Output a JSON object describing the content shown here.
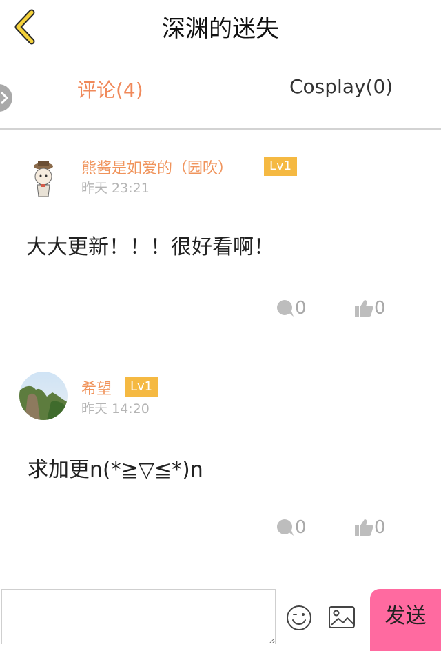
{
  "header": {
    "title": "深渊的迷失"
  },
  "tabs": [
    {
      "label": "评论(4)",
      "active": true
    },
    {
      "label": "Cosplay(0)",
      "active": false
    }
  ],
  "comments": [
    {
      "username": "熊酱是如爱的（园吹）",
      "level": "Lv1",
      "time": "昨天 23:21",
      "content": "大大更新！！！很好看啊！",
      "reply_count": "0",
      "like_count": "0"
    },
    {
      "username": "希望",
      "level": "Lv1",
      "time": "昨天 14:20",
      "content": "求加更n(*≧▽≦*)n",
      "reply_count": "0",
      "like_count": "0"
    }
  ],
  "input_bar": {
    "placeholder": "",
    "send_label": "发送"
  },
  "colors": {
    "accent": "#f0895a",
    "badge": "#f5b942",
    "send": "#ff6aa0",
    "back_icon": "#f5d23b"
  },
  "icons": [
    "back-chevron-icon",
    "side-arrow-icon",
    "comment-bubble-icon",
    "thumbs-up-icon",
    "emoji-icon",
    "image-icon"
  ]
}
